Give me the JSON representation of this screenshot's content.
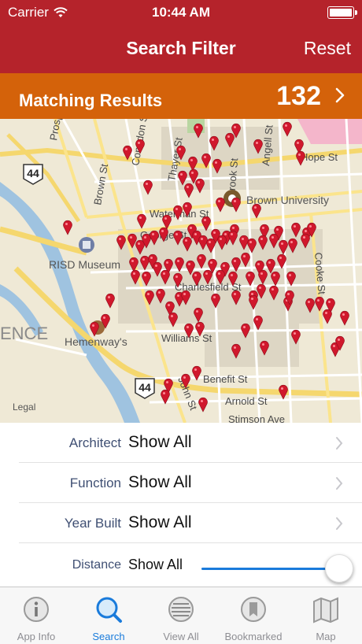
{
  "status": {
    "carrier": "Carrier",
    "time": "10:44 AM"
  },
  "nav": {
    "title": "Search Filter",
    "reset": "Reset"
  },
  "results": {
    "label": "Matching Results",
    "count": "132"
  },
  "map": {
    "streets": [
      "Prospect St",
      "Congdon St",
      "Brown St",
      "Thayer St",
      "Brook St",
      "Angell St",
      "Waterman St",
      "George St",
      "Charlesfield St",
      "Williams St",
      "Benefit St",
      "John St",
      "Arnold St",
      "Stimson Ave",
      "Hope St",
      "Cooke St"
    ],
    "places": [
      "Brown University",
      "RISD Museum",
      "Hemenway's",
      "ENCE"
    ],
    "highway_shields": [
      "44",
      "44"
    ],
    "legal": "Legal",
    "pin_color": "#d0182c"
  },
  "filters": [
    {
      "label": "Architect",
      "value": "Show All"
    },
    {
      "label": "Function",
      "value": "Show All"
    },
    {
      "label": "Year Built",
      "value": "Show All"
    }
  ],
  "distance": {
    "label": "Distance",
    "value": "Show All",
    "slider_level": 0.95
  },
  "tabs": [
    {
      "label": "App Info",
      "icon": "info-icon",
      "active": false
    },
    {
      "label": "Search",
      "icon": "search-icon",
      "active": true
    },
    {
      "label": "View All",
      "icon": "list-icon",
      "active": false
    },
    {
      "label": "Bookmarked",
      "icon": "bookmark-icon",
      "active": false
    },
    {
      "label": "Map",
      "icon": "map-icon",
      "active": false
    }
  ],
  "colors": {
    "header": "#b5232b",
    "results_bar": "#d4620a",
    "accent": "#1a7bdb",
    "label": "#3f4f73"
  }
}
